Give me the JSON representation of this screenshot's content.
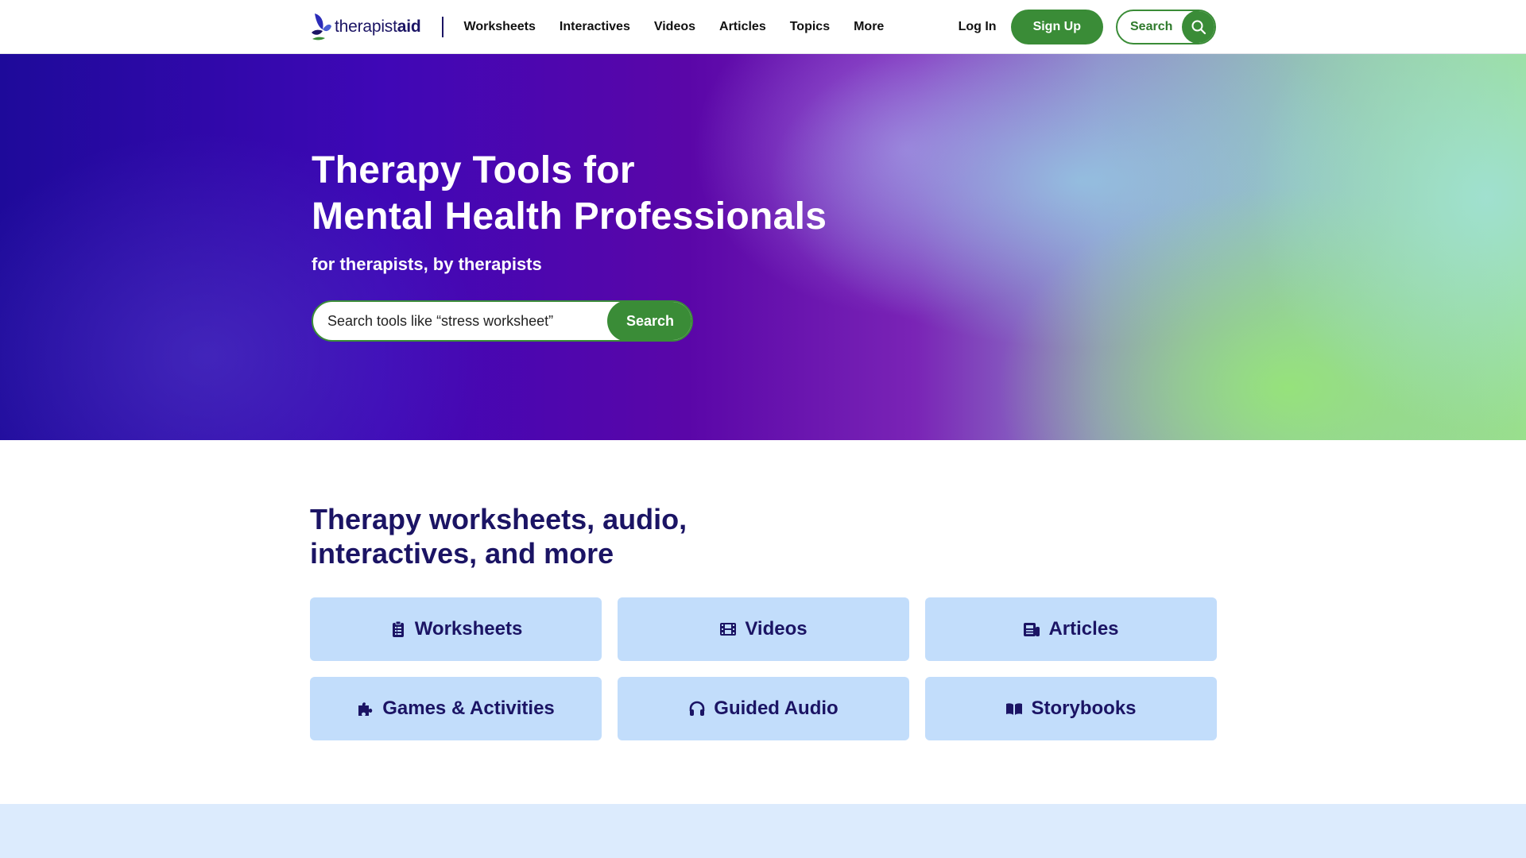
{
  "header": {
    "logo_light": "therapist",
    "logo_bold": "aid",
    "nav": [
      {
        "label": "Worksheets"
      },
      {
        "label": "Interactives"
      },
      {
        "label": "Videos"
      },
      {
        "label": "Articles"
      },
      {
        "label": "Topics"
      },
      {
        "label": "More"
      }
    ],
    "login_label": "Log In",
    "signup_label": "Sign Up",
    "search_label": "Search"
  },
  "hero": {
    "title_line1": "Therapy Tools for",
    "title_line2": "Mental Health Professionals",
    "subtitle": "for therapists, by therapists",
    "search_placeholder": "Search tools like “stress worksheet”",
    "search_button": "Search"
  },
  "section": {
    "title_line1": "Therapy worksheets, audio,",
    "title_line2": "interactives, and more"
  },
  "categories": [
    {
      "label": "Worksheets",
      "icon": "clipboard-list-icon"
    },
    {
      "label": "Videos",
      "icon": "film-icon"
    },
    {
      "label": "Articles",
      "icon": "newspaper-icon"
    },
    {
      "label": "Games & Activities",
      "icon": "puzzle-piece-icon"
    },
    {
      "label": "Guided Audio",
      "icon": "headphones-icon"
    },
    {
      "label": "Storybooks",
      "icon": "open-book-icon"
    }
  ],
  "colors": {
    "brand_green": "#3a8c37",
    "brand_navy": "#1b1464",
    "card_bg": "#c2ddfb"
  }
}
